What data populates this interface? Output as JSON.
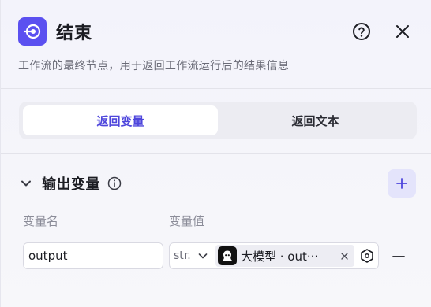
{
  "header": {
    "title": "结束",
    "description": "工作流的最终节点，用于返回工作流运行后的结果信息"
  },
  "tabs": [
    {
      "label": "返回变量",
      "active": true
    },
    {
      "label": "返回文本",
      "active": false
    }
  ],
  "section": {
    "title": "输出变量",
    "columns": {
      "name": "变量名",
      "value": "变量值"
    }
  },
  "rows": [
    {
      "name": "output",
      "type": "str.",
      "ref_label": "大模型 · out···"
    }
  ],
  "icons": {
    "node": "end-node-icon",
    "help": "help-circle-icon",
    "close": "close-icon",
    "collapse": "chevron-down-icon",
    "info": "info-icon",
    "add": "plus-icon",
    "ref_source": "llm-model-icon",
    "remove_ref": "close-icon",
    "variable_picker": "variable-hexagon-icon",
    "remove_row": "minus-icon"
  },
  "colors": {
    "accent": "#5b50f0",
    "active_tab_text": "#4e46dc",
    "add_button_bg": "#e4e4fb"
  }
}
